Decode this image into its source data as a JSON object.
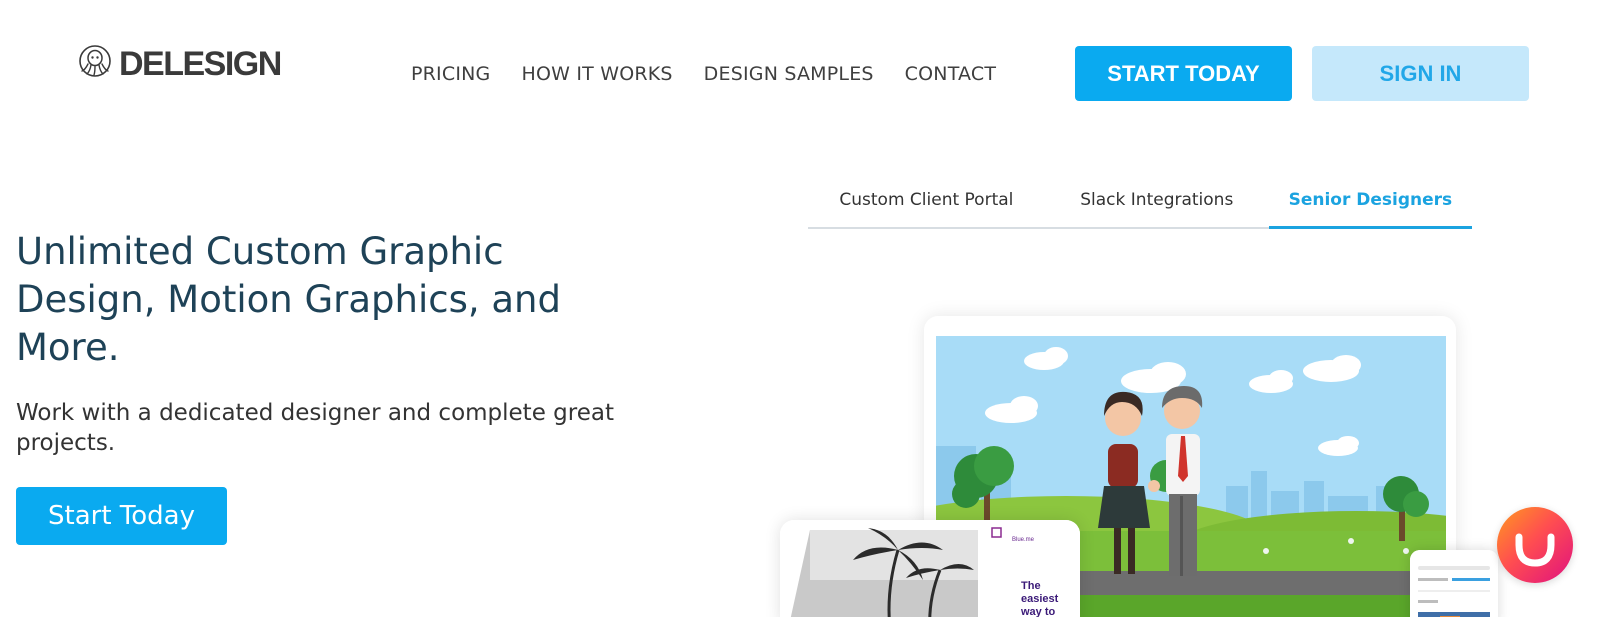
{
  "brand": {
    "name": "DELESIGN"
  },
  "nav": {
    "items": [
      "PRICING",
      "HOW IT WORKS",
      "DESIGN SAMPLES",
      "CONTACT"
    ]
  },
  "header": {
    "start_label": "START TODAY",
    "signin_label": "SIGN IN"
  },
  "hero": {
    "title": "Unlimited Custom Graphic Design, Motion Graphics, and More.",
    "subtitle": "Work with a dedicated designer and complete great projects.",
    "cta_label": "Start Today"
  },
  "tabs": {
    "items": [
      "Custom Client Portal",
      "Slack Integrations",
      "Senior Designers"
    ],
    "active": "Senior Designers"
  },
  "illustration": {
    "card_brand": "Blue.me",
    "card_title": "The easiest way to create illustrations"
  },
  "colors": {
    "accent": "#0aaaf0",
    "accent_light": "#c5e8fb",
    "heading": "#1e4257",
    "tab_active": "#1ba3e0"
  },
  "icons": {
    "logo": "octopus-logo-icon",
    "chat": "chat-widget-icon"
  }
}
